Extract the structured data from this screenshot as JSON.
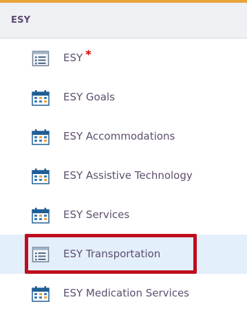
{
  "colors": {
    "top_accent": "#e8a33a",
    "highlight_border": "#c00d1e",
    "selected_row_bg": "#e3effb",
    "required_mark": "#cc0000"
  },
  "section": {
    "title": "ESY"
  },
  "items": [
    {
      "label": "ESY",
      "icon": "list-form-icon",
      "required": true,
      "required_mark": "*"
    },
    {
      "label": "ESY Goals",
      "icon": "calendar-icon"
    },
    {
      "label": "ESY Accommodations",
      "icon": "calendar-icon"
    },
    {
      "label": "ESY Assistive Technology",
      "icon": "calendar-icon"
    },
    {
      "label": "ESY Services",
      "icon": "calendar-icon"
    },
    {
      "label": "ESY Transportation",
      "icon": "list-form-icon",
      "selected": true,
      "highlighted": true
    },
    {
      "label": "ESY Medication Services",
      "icon": "calendar-icon"
    }
  ]
}
